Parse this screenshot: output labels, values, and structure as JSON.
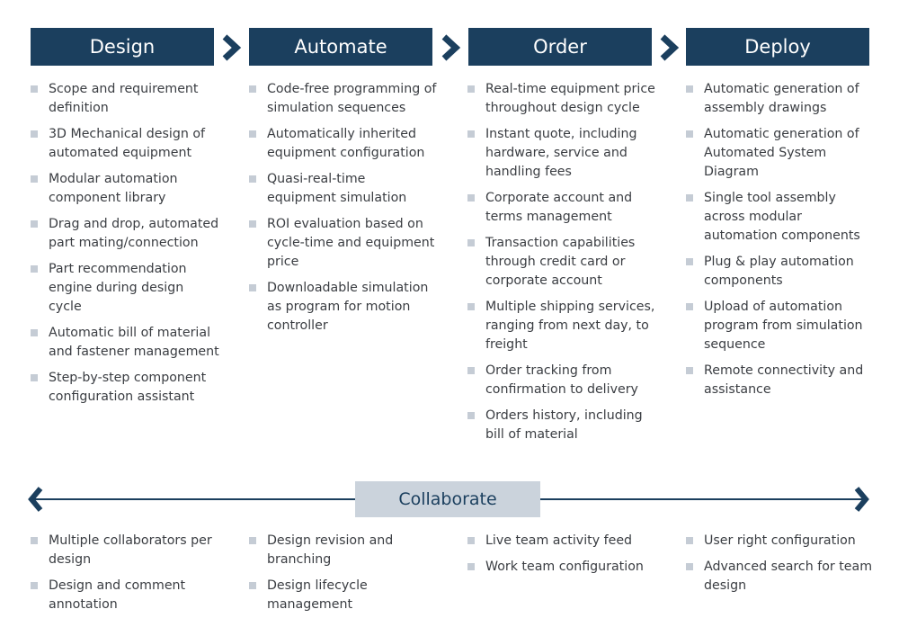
{
  "stages": [
    {
      "label": "Design",
      "items": [
        "Scope and requirement definition",
        "3D Mechanical design of automated equipment",
        "Modular automation component library",
        "Drag and drop, automated part mating/connection",
        "Part recommendation engine during design cycle",
        "Automatic bill of material and fastener management",
        "Step-by-step component configuration assistant"
      ]
    },
    {
      "label": "Automate",
      "items": [
        "Code-free programming of simulation sequences",
        "Automatically inherited equipment configuration",
        "Quasi-real-time equipment simulation",
        "ROI evaluation based on cycle-time and equipment price",
        "Downloadable simulation as program for motion controller"
      ]
    },
    {
      "label": "Order",
      "items": [
        "Real-time equipment price throughout design cycle",
        "Instant quote, including hardware, service and handling fees",
        "Corporate account and terms management",
        "Transaction capabilities through credit card or corporate account",
        "Multiple shipping services, ranging from next day, to freight",
        "Order tracking from confirmation to delivery",
        "Orders history, including bill of material"
      ]
    },
    {
      "label": "Deploy",
      "items": [
        "Automatic generation of assembly drawings",
        "Automatic generation of Automated System Diagram",
        "Single tool assembly across modular automation components",
        "Plug & play automation components",
        "Upload of automation program from simulation sequence",
        "Remote connectivity and assistance"
      ]
    }
  ],
  "collaborate": {
    "label": "Collaborate",
    "columns": [
      [
        "Multiple collaborators per design",
        "Design and comment annotation"
      ],
      [
        "Design revision and branching",
        "Design lifecycle management"
      ],
      [
        "Live team activity feed",
        "Work team configuration"
      ],
      [
        "User right configuration",
        "Advanced search for team design"
      ]
    ]
  },
  "colors": {
    "primary": "#1b3f5e",
    "collab_box": "#cbd3dc",
    "bullet": "#c5ccd5",
    "text": "#3a3d42"
  }
}
